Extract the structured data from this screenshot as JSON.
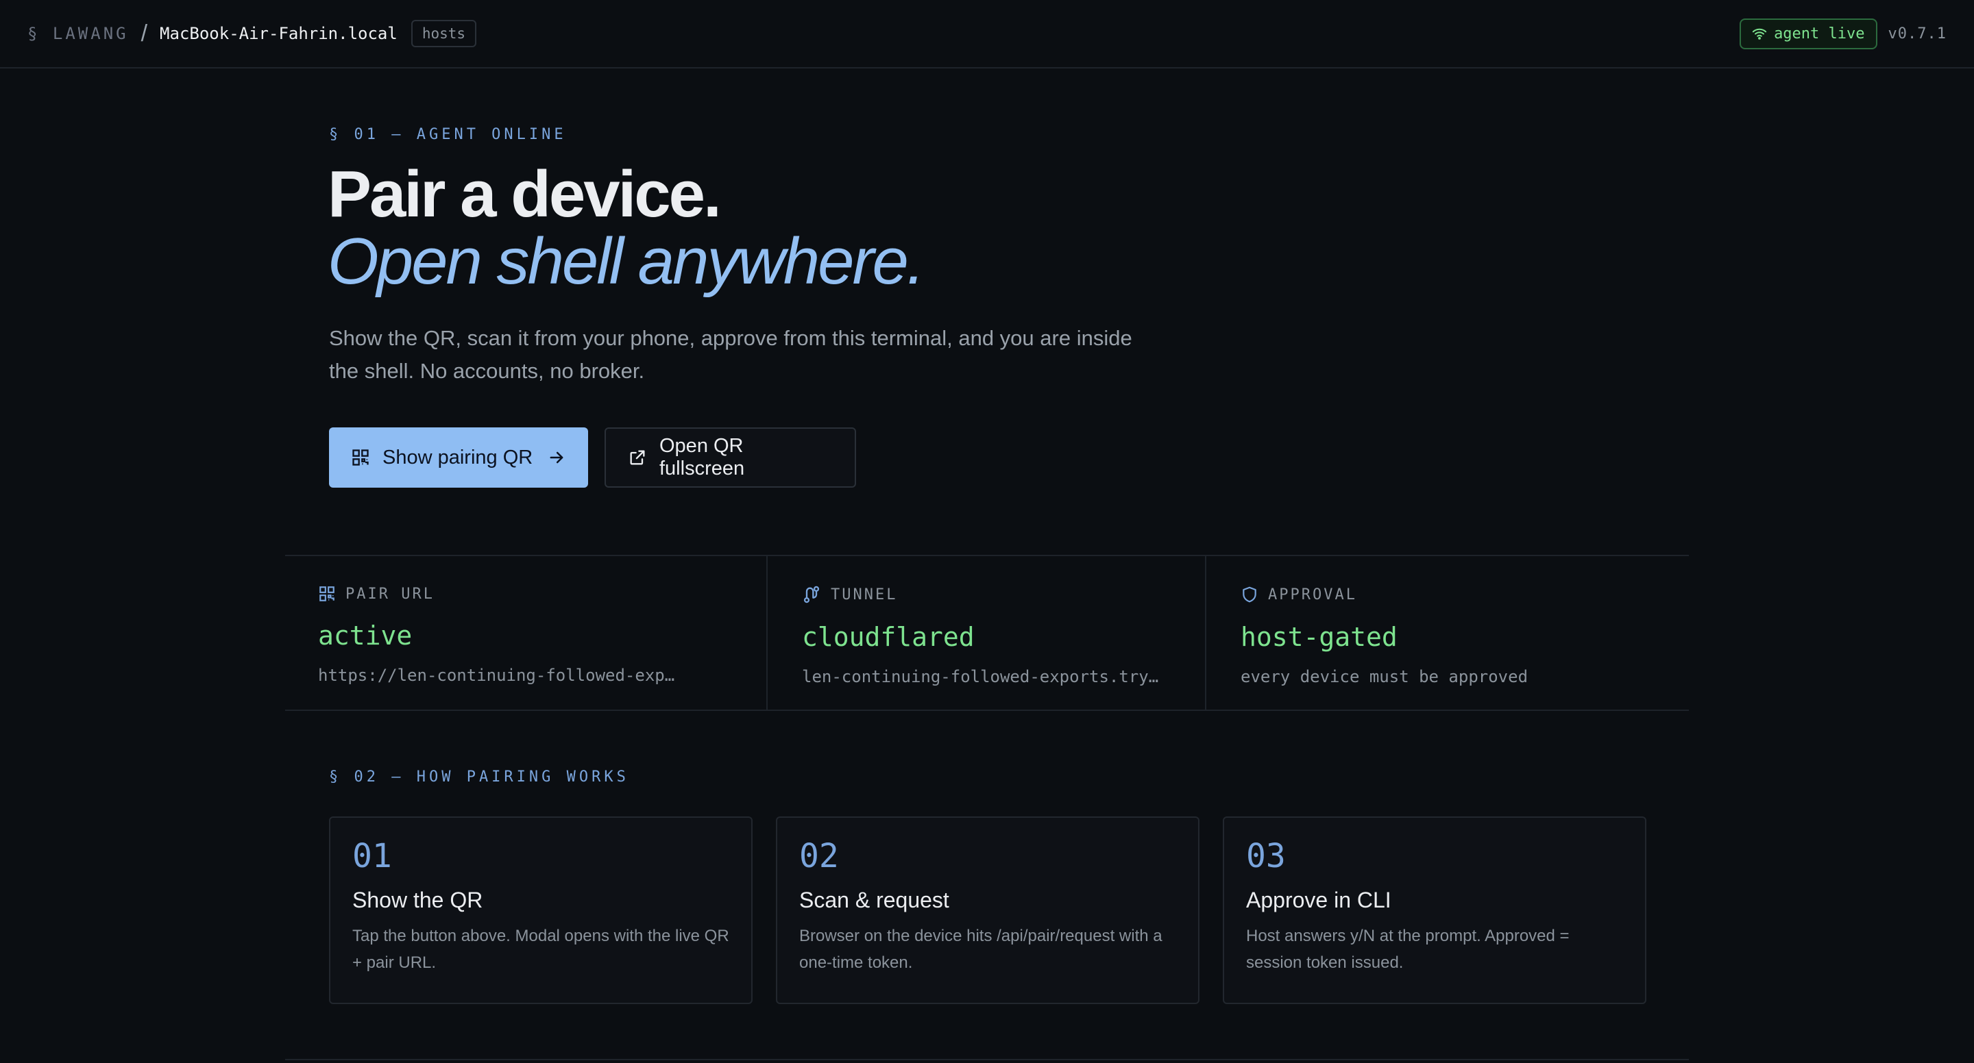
{
  "header": {
    "brand_section": "§ LAWANG",
    "separator": "/",
    "hostname": "MacBook-Air-Fahrin.local",
    "hosts_tag": "hosts",
    "status_badge": "agent live",
    "version": "v0.7.1"
  },
  "hero": {
    "eyebrow": "§ 01 — AGENT ONLINE",
    "title_line1": "Pair a device.",
    "title_line2": "Open shell anywhere.",
    "lede": "Show the QR, scan it from your phone, approve from this terminal, and you are inside the shell. No accounts, no broker.",
    "primary_button": "Show pairing QR",
    "secondary_button": "Open QR fullscreen"
  },
  "stats": [
    {
      "icon": "qr-code-icon",
      "label": "PAIR URL",
      "value": "active",
      "sub": "https://len-continuing-followed-exp…"
    },
    {
      "icon": "route-icon",
      "label": "TUNNEL",
      "value": "cloudflared",
      "sub": "len-continuing-followed-exports.tryc…"
    },
    {
      "icon": "shield-icon",
      "label": "APPROVAL",
      "value": "host-gated",
      "sub": "every device must be approved"
    }
  ],
  "how": {
    "eyebrow": "§ 02 — HOW PAIRING WORKS",
    "steps": [
      {
        "num": "01",
        "title": "Show the QR",
        "desc": "Tap the button above. Modal opens with the live QR + pair URL."
      },
      {
        "num": "02",
        "title": "Scan & request",
        "desc": "Browser on the device hits /api/pair/request with a one-time token."
      },
      {
        "num": "03",
        "title": "Approve in CLI",
        "desc": "Host answers y/N at the prompt. Approved = session token issued."
      }
    ]
  },
  "colors": {
    "background": "#0b0e12",
    "accent_blue": "#8fbdf3",
    "status_green": "#7ee38f",
    "muted": "#8b939c"
  }
}
